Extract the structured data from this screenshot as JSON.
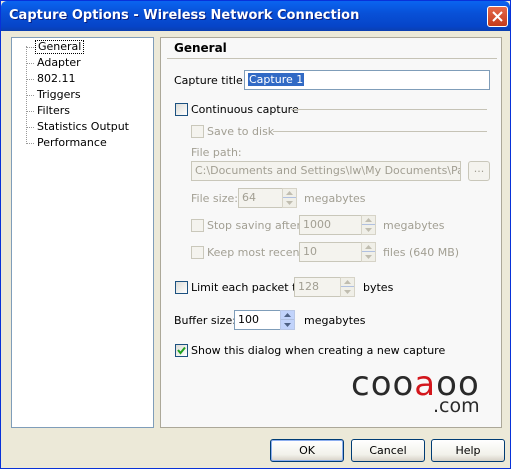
{
  "window": {
    "title": "Capture Options - Wireless Network Connection"
  },
  "nav": {
    "items": [
      {
        "label": "General",
        "selected": true
      },
      {
        "label": "Adapter"
      },
      {
        "label": "802.11"
      },
      {
        "label": "Triggers"
      },
      {
        "label": "Filters"
      },
      {
        "label": "Statistics Output"
      },
      {
        "label": "Performance"
      }
    ]
  },
  "general": {
    "heading": "General",
    "capture_title_label": "Capture title:",
    "capture_title_value": "Capture 1",
    "continuous_capture": {
      "label": "Continuous capture",
      "checked": false
    },
    "save_to_disk": {
      "label": "Save to disk",
      "checked": false,
      "enabled": false
    },
    "file_path_label": "File path:",
    "file_path_value": "C:\\Documents and Settings\\lw\\My Documents\\Packet",
    "browse_label": "...",
    "file_size_label": "File size:",
    "file_size_value": "64",
    "file_size_unit": "megabytes",
    "stop_saving": {
      "label": "Stop saving after",
      "checked": false,
      "value": "1000",
      "unit": "megabytes"
    },
    "keep_most_recent": {
      "label": "Keep most recent",
      "checked": false,
      "value": "10",
      "unit": "files (640 MB)"
    },
    "limit_packet": {
      "label": "Limit each packet to",
      "checked": false,
      "value": "128",
      "unit": "bytes"
    },
    "buffer_size": {
      "label": "Buffer size:",
      "value": "100",
      "unit": "megabytes"
    },
    "show_dialog": {
      "label": "Show this dialog when creating a new capture",
      "checked": true
    }
  },
  "logo": {
    "text_top_left": "coo",
    "text_top_red": "a",
    "text_top_right": "oo",
    "text_bottom": ".com"
  },
  "buttons": {
    "ok": "OK",
    "cancel": "Cancel",
    "help": "Help"
  }
}
